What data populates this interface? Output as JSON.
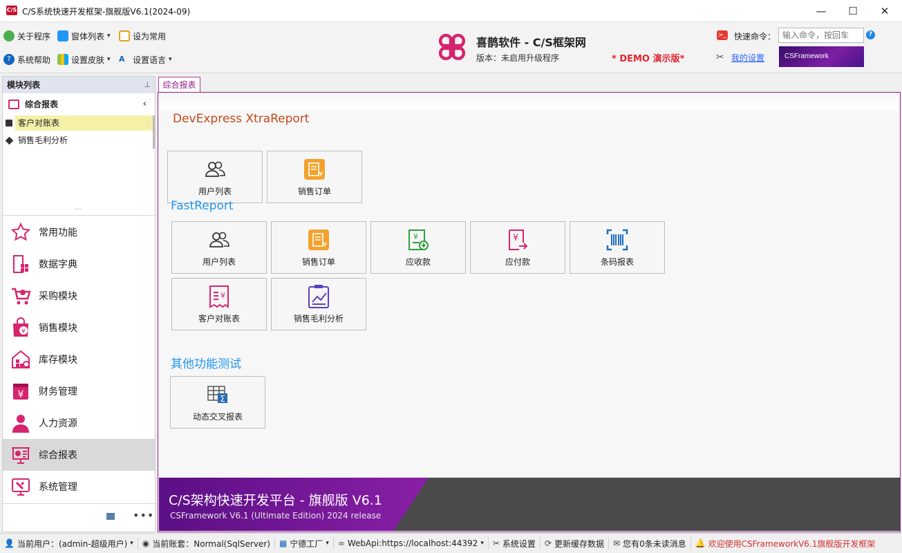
{
  "window": {
    "title": "C/S系统快速开发框架-旗舰版V6.1(2024-09)",
    "minimize": "—",
    "maximize": "☐",
    "close": "✕"
  },
  "ribbon": {
    "about": "关于程序",
    "window_list": "窗体列表",
    "set_common": "设为常用",
    "help": "系统帮助",
    "skin": "设置皮肤",
    "language": "设置语言",
    "brand_title": "喜鹊软件 - C/S框架网",
    "brand_version": "版本：未启用升级程序",
    "demo_label": "* DEMO 演示版*",
    "command_label": "快速命令：",
    "command_placeholder": "输入命令，按回车",
    "my_settings": "我的设置",
    "banner": "CSFramework"
  },
  "left_panel": {
    "header": "模块列表",
    "group_title": "综合报表",
    "tree_items": [
      "客户对账表",
      "销售毛利分析"
    ],
    "ellipsis": "...",
    "nav_items": [
      "常用功能",
      "数据字典",
      "采购模块",
      "销售模块",
      "库存模块",
      "财务管理",
      "人力资源",
      "综合报表",
      "系统管理"
    ],
    "selected_nav": "综合报表"
  },
  "main": {
    "tab_label": "综合报表",
    "section1_title": "DevExpress XtraReport",
    "section1_tiles": [
      "用户列表",
      "销售订单"
    ],
    "section2_title": "FastReport",
    "section2_tiles": [
      "用户列表",
      "销售订单",
      "应收款",
      "应付款",
      "条码报表",
      "客户对账表",
      "销售毛利分析"
    ],
    "section3_title": "其他功能测试",
    "section3_tiles": [
      "动态交叉报表"
    ],
    "footer_title": "C/S架构快速开发平台 - 旗舰版 V6.1",
    "footer_subtitle": "CSFramework V6.1 (Ultimate Edition) 2024 release"
  },
  "statusbar": {
    "user": "当前用户：(admin-超级用户)",
    "account": "当前账套：Normal(SqlServer)",
    "factory": "宁德工厂",
    "webapi": "WebApi:https://localhost:44392",
    "settings": "系统设置",
    "refresh": "更新缓存数据",
    "messages": "您有0条未读消息",
    "welcome": "欢迎使用CSFrameworkV6.1旗舰版开发框架"
  },
  "colors": {
    "accent": "#8e1f8a",
    "brand_pink": "#d6246e",
    "demo_red": "#e0242e",
    "section1": "#c0481a",
    "section2": "#2196f3"
  }
}
